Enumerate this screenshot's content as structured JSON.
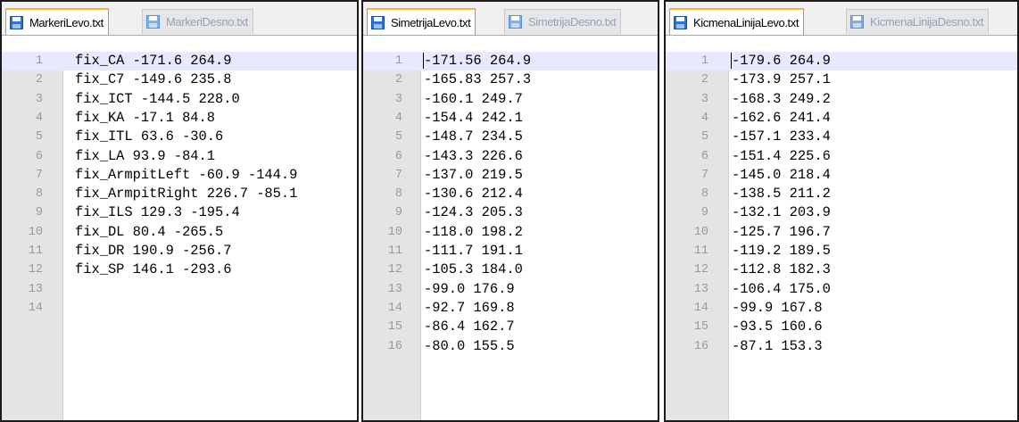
{
  "panels": [
    {
      "tabs": [
        {
          "label": "MarkeriLevo.txt",
          "active": true
        },
        {
          "label": "MarkeriDesno.txt",
          "active": false
        }
      ],
      "line_numbers": [
        "1",
        "2",
        "3",
        "4",
        "5",
        "6",
        "7",
        "8",
        "9",
        "10",
        "11",
        "12",
        "13",
        "14"
      ],
      "lines": [
        "fix_CA -171.6 264.9",
        "fix_C7 -149.6 235.8",
        "fix_ICT -144.5 228.0",
        "fix_KA -17.1 84.8",
        "fix_ITL 63.6 -30.6",
        "fix_LA 93.9 -84.1",
        "fix_ArmpitLeft -60.9 -144.9",
        "fix_ArmpitRight 226.7 -85.1",
        "fix_ILS 129.3 -195.4",
        "fix_DL 80.4 -265.5",
        "fix_DR 190.9 -256.7",
        "fix_SP 146.1 -293.6",
        "",
        ""
      ]
    },
    {
      "tabs": [
        {
          "label": "SimetrijaLevo.txt",
          "active": true
        },
        {
          "label": "SimetrijaDesno.txt",
          "active": false
        }
      ],
      "line_numbers": [
        "1",
        "2",
        "3",
        "4",
        "5",
        "6",
        "7",
        "8",
        "9",
        "10",
        "11",
        "12",
        "13",
        "14",
        "15",
        "16"
      ],
      "lines": [
        "-171.56 264.9",
        "-165.83 257.3",
        "-160.1 249.7",
        "-154.4 242.1",
        "-148.7 234.5",
        "-143.3 226.6",
        "-137.0 219.5",
        "-130.6 212.4",
        "-124.3 205.3",
        "-118.0 198.2",
        "-111.7 191.1",
        "-105.3 184.0",
        "-99.0 176.9",
        "-92.7 169.8",
        "-86.4 162.7",
        "-80.0 155.5"
      ]
    },
    {
      "tabs": [
        {
          "label": "KicmenaLinijaLevo.txt",
          "active": true
        },
        {
          "label": "KicmenaLinijaDesno.txt",
          "active": false
        }
      ],
      "line_numbers": [
        "1",
        "2",
        "3",
        "4",
        "5",
        "6",
        "7",
        "8",
        "9",
        "10",
        "11",
        "12",
        "13",
        "14",
        "15",
        "16"
      ],
      "lines": [
        "-179.6 264.9",
        "-173.9 257.1",
        "-168.3 249.2",
        "-162.6 241.4",
        "-157.1 233.4",
        "-151.4 225.6",
        "-145.0 218.4",
        "-138.5 211.2",
        "-132.1 203.9",
        "-125.7 196.7",
        "-119.2 189.5",
        "-112.8 182.3",
        "-106.4 175.0",
        "-99.9 167.8",
        "-93.5 160.6",
        "-87.1 153.3"
      ]
    }
  ]
}
